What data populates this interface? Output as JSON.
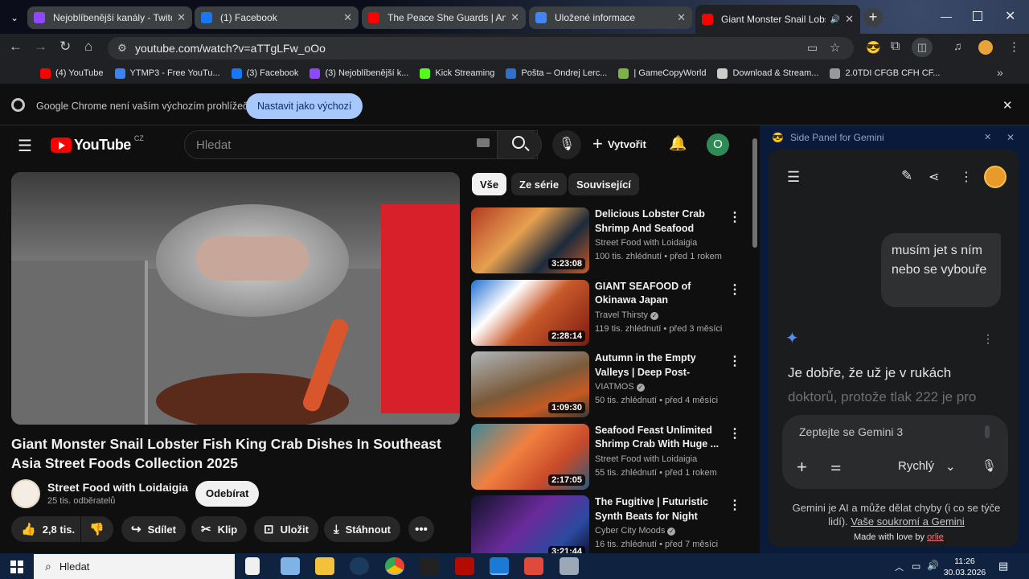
{
  "browser": {
    "tabs": [
      {
        "title": "Nejoblíbenější kanály - Twitch",
        "color": "#9146ff"
      },
      {
        "title": "(1) Facebook",
        "color": "#1877f2"
      },
      {
        "title": "The Peace She Guards | Ambien",
        "color": "#ff0000"
      },
      {
        "title": "Uložené informace",
        "color": "#4285f4"
      },
      {
        "title": "Giant Monster Snail Lobster",
        "color": "#ff0000"
      }
    ],
    "url": "youtube.com/watch?v=aTTgLFw_oOo",
    "bookmarks": [
      {
        "label": "(4) YouTube",
        "color": "#ff0000"
      },
      {
        "label": "YTMP3 - Free YouTu...",
        "color": "#3b82f6"
      },
      {
        "label": "(3) Facebook",
        "color": "#1877f2"
      },
      {
        "label": "(3) Nejoblíbenější k...",
        "color": "#9146ff"
      },
      {
        "label": "Kick Streaming",
        "color": "#53fc18"
      },
      {
        "label": "Pošta – Ondrej Lerc...",
        "color": "#2f6fd0"
      },
      {
        "label": "| GameCopyWorld",
        "color": "#7cb342"
      },
      {
        "label": "Download & Stream...",
        "color": "#cccccc"
      },
      {
        "label": "2.0TDI CFGB CFH CF...",
        "color": "#999999"
      }
    ],
    "infobar": {
      "text": "Google Chrome není vaším výchozím prohlížečem",
      "button": "Nastavit jako výchozí"
    }
  },
  "youtube": {
    "logo": "YouTube",
    "region": "CZ",
    "search_placeholder": "Hledat",
    "create_label": "Vytvořit",
    "avatar_letter": "O",
    "video": {
      "title": "Giant Monster Snail Lobster Fish King Crab Dishes In Southeast Asia Street Foods Collection 2025",
      "channel": "Street Food with Loidaigia",
      "subscribers": "25 tis. odběratelů",
      "subscribe": "Odebírat",
      "likes": "2,8 tis.",
      "share": "Sdílet",
      "clip": "Klip",
      "save": "Uložit",
      "download": "Stáhnout"
    },
    "chips": [
      "Vše",
      "Ze série",
      "Související"
    ],
    "recommendations": [
      {
        "title": "Delicious Lobster Crab Shrimp And Seafood Dishe...",
        "channel": "Street Food with Loidaigia",
        "meta": "100 tis. zhlédnutí • před 1 rokem",
        "duration": "3:23:08",
        "verified": false
      },
      {
        "title": "GIANT SEAFOOD of Okinawa Japan",
        "channel": "Travel Thirsty",
        "meta": "119 tis. zhlédnutí • před 3 měsíci",
        "duration": "2:28:14",
        "verified": true
      },
      {
        "title": "Autumn in the Empty Valleys | Deep Post-Apocalyptic ...",
        "channel": "VIATMOS",
        "meta": "50 tis. zhlédnutí • před 4 měsíci",
        "duration": "1:09:30",
        "verified": true
      },
      {
        "title": "Seafood Feast Unlimited Shrimp Crab With Huge ...",
        "channel": "Street Food with Loidaigia",
        "meta": "55 tis. zhlédnutí • před 1 rokem",
        "duration": "2:17:05",
        "verified": false
      },
      {
        "title": "The Fugitive | Futuristic Synth Beats for Night Drive...",
        "channel": "Cyber City Moods",
        "meta": "16 tis. zhlédnutí • před 7 měsíci",
        "duration": "3:21:44",
        "verified": true
      }
    ]
  },
  "gemini": {
    "panel_title": "Side Panel for Gemini",
    "user_message": "musím jet s ním nebo se vybouře",
    "reply_bold": "Je dobře, že už je v rukách",
    "reply_faded": "doktorů, protože tlak 222 je pro",
    "input_placeholder": "Zeptejte se Gemini 3",
    "mode": "Rychlý",
    "disclaimer": "Gemini je AI a může dělat chyby (i co se týče lidí).",
    "privacy_link": "Vaše soukromí a Gemini",
    "made_with": "Made with love by",
    "author": "orlie"
  },
  "taskbar": {
    "search": "Hledat",
    "time": "11:26",
    "date": "30.03.2026"
  }
}
